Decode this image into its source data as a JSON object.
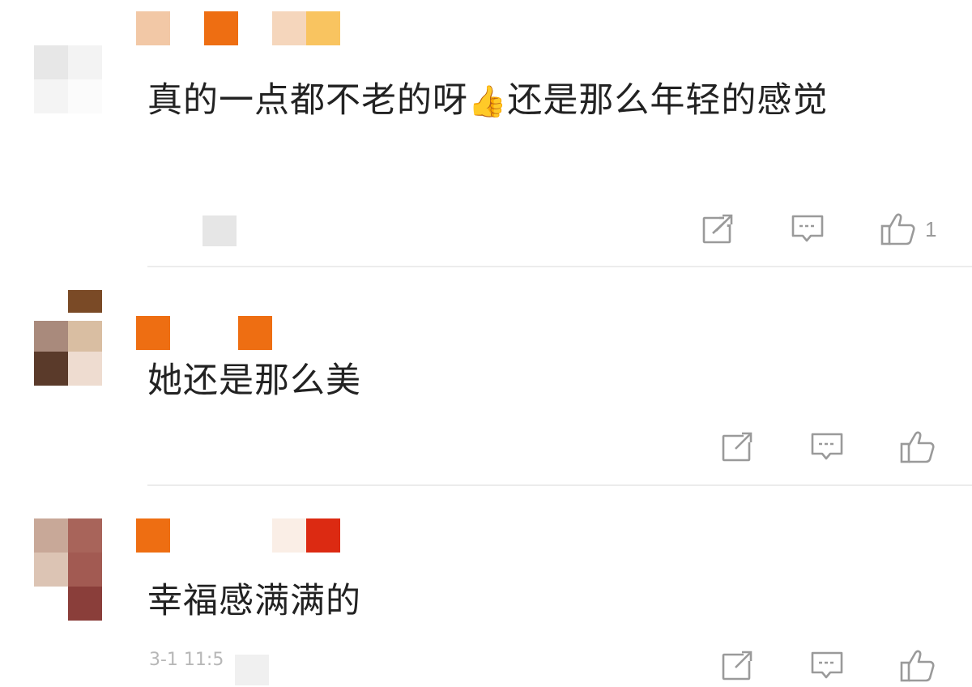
{
  "colors": {
    "text": "#222222",
    "icon": "#9a9a9a",
    "divider": "#ececec",
    "accent_orange": "#f07214"
  },
  "comments": [
    {
      "text_before_emoji": "真的一点都不老的呀",
      "emoji": "👍",
      "text_after_emoji": "还是那么年轻的感觉",
      "like_count": "1",
      "share_icon": "share-icon",
      "reply_icon": "comment-icon",
      "like_icon": "thumbs-up-icon"
    },
    {
      "text": "她还是那么美",
      "like_count": "",
      "share_icon": "share-icon",
      "reply_icon": "comment-icon",
      "like_icon": "thumbs-up-icon"
    },
    {
      "text": "幸福感满满的",
      "timestamp": "3-1 11:5",
      "like_count": "",
      "share_icon": "share-icon",
      "reply_icon": "comment-icon",
      "like_icon": "thumbs-up-icon"
    }
  ]
}
